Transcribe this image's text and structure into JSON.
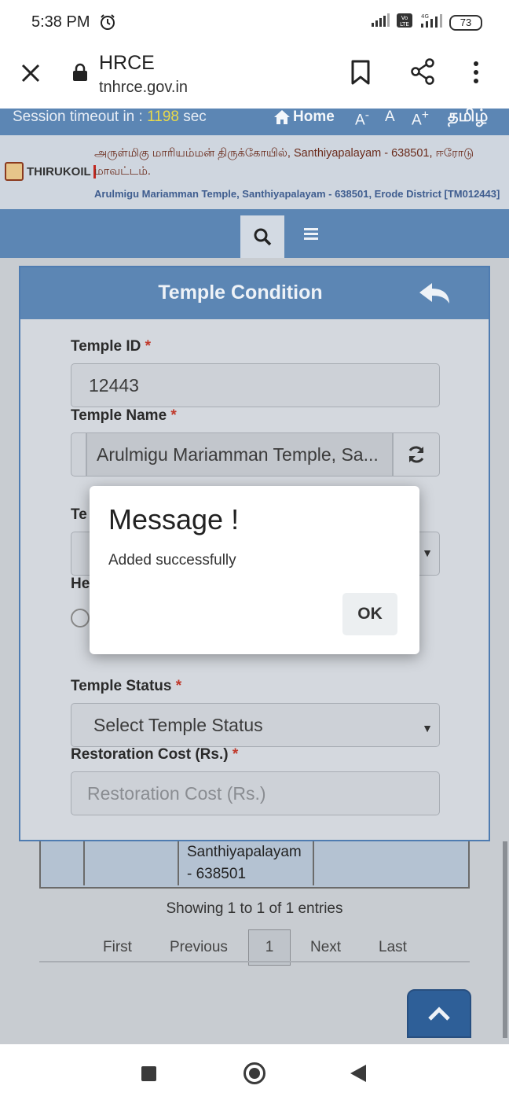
{
  "status_bar": {
    "time": "5:38 PM",
    "battery": "73",
    "network": "4G",
    "volte": "Vo LTE"
  },
  "browser": {
    "title": "HRCE",
    "url": "tnhrce.gov.in"
  },
  "top_strip": {
    "session_label": "Session timeout in : ",
    "session_seconds": "1198",
    "session_unit": " sec",
    "home": "Home",
    "font_small": "A",
    "font_small_sup": "-",
    "font_normal": "A",
    "font_large": "A",
    "font_large_sup": "+",
    "language": "தமிழ்"
  },
  "temple_header": {
    "logo_text": "THIRUKOIL",
    "tamil_name": "அருள்மிகு மாரியம்மன் திருக்கோயில், Santhiyapalayam - 638501, ஈரோடு மாவட்டம்.",
    "english_name": "Arulmigu Mariamman Temple, Santhiyapalayam - 638501, Erode District [TM012443]"
  },
  "panel": {
    "title": "Temple Condition",
    "temple_id_label": "Temple ID",
    "temple_id_value": "12443",
    "temple_name_label": "Temple Name",
    "temple_name_value": "Arulmigu Mariamman Temple, Sa...",
    "hidden_label_1": "Te",
    "hidden_label_2": "He",
    "temple_status_label": "Temple Status",
    "temple_status_value": "Select Temple Status",
    "restoration_label": "Restoration Cost (Rs.)",
    "restoration_placeholder": "Restoration Cost (Rs.)",
    "required_mark": "*"
  },
  "table_remnant": {
    "cell_line_1": "Santhiyapalayam",
    "cell_line_2": "- 638501"
  },
  "pagination": {
    "info": "Showing 1 to 1 of 1 entries",
    "first": "First",
    "previous": "Previous",
    "current": "1",
    "next": "Next",
    "last": "Last"
  },
  "alert": {
    "title": "Message !",
    "message": "Added successfully",
    "ok": "OK"
  },
  "colors": {
    "brand_blue": "#5c86b4",
    "session_highlight": "#e8d94a",
    "required": "#c0392b"
  }
}
